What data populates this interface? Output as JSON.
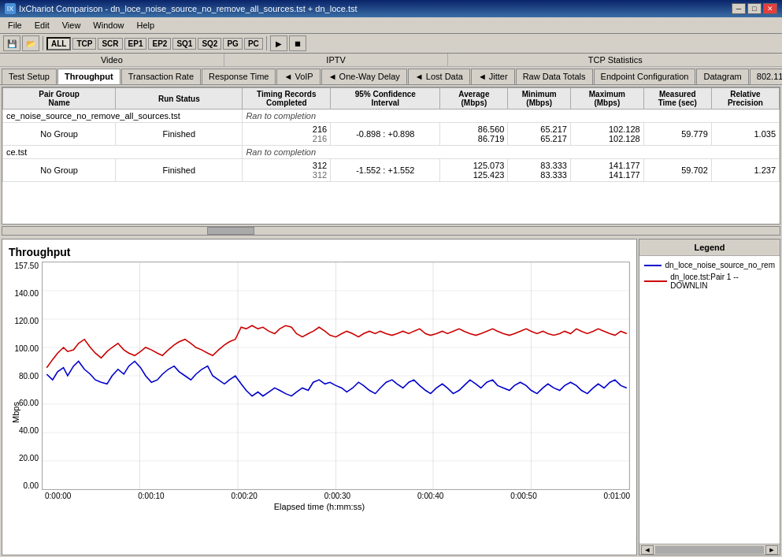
{
  "window": {
    "title": "IxChariot Comparison - dn_loce_noise_source_no_remove_all_sources.tst + dn_loce.tst"
  },
  "titlebar": {
    "minimize": "─",
    "maximize": "□",
    "close": "✕"
  },
  "menu": {
    "items": [
      "File",
      "Edit",
      "View",
      "Window",
      "Help"
    ]
  },
  "toolbar": {
    "tags": [
      "ALL",
      "TCP",
      "SCR",
      "EP1",
      "EP2",
      "SQ1",
      "SQ2",
      "PG",
      "PC"
    ]
  },
  "tabs_top": {
    "video_label": "Video",
    "iptv_label": "IPTV",
    "tcp_label": "TCP Statistics"
  },
  "tabs_main": [
    {
      "label": "Test Setup"
    },
    {
      "label": "Throughput"
    },
    {
      "label": "Transaction Rate"
    },
    {
      "label": "Response Time"
    },
    {
      "label": "◄ VoIP"
    },
    {
      "label": "◄ One-Way Delay"
    },
    {
      "label": "◄ Lost Data"
    },
    {
      "label": "◄ Jitter"
    },
    {
      "label": "Raw Data Totals"
    },
    {
      "label": "Endpoint Configuration"
    },
    {
      "label": "Datagram"
    },
    {
      "label": "802.11"
    }
  ],
  "table": {
    "headers": [
      {
        "label": "Pair Group\nName",
        "width": "80"
      },
      {
        "label": "Run Status",
        "width": "90"
      },
      {
        "label": "Timing Records\nCompleted",
        "width": "70"
      },
      {
        "label": "95% Confidence\nInterval",
        "width": "100"
      },
      {
        "label": "Average\n(Mbps)",
        "width": "60"
      },
      {
        "label": "Minimum\n(Mbps)",
        "width": "60"
      },
      {
        "label": "Maximum\n(Mbps)",
        "width": "70"
      },
      {
        "label": "Measured\nTime (sec)",
        "width": "65"
      },
      {
        "label": "Relative\nPrecision",
        "width": "65"
      }
    ],
    "rows": [
      {
        "type": "file",
        "filename": "ce_noise_source_no_remove_all_sources.tst",
        "completion": "Ran to completion",
        "group": "",
        "status": "",
        "records": "",
        "confidence": "",
        "avg": "",
        "min": "",
        "max": "",
        "time": "",
        "precision": ""
      },
      {
        "type": "data",
        "filename": "",
        "completion": "",
        "group": "No Group",
        "status": "Finished",
        "records": "216",
        "confidence": "-0.898 : +0.898",
        "avg": "86.560\n86.719",
        "min": "65.217\n65.217",
        "max": "102.128\n102.128",
        "time": "59.779",
        "precision": "1.035"
      },
      {
        "type": "file",
        "filename": "ce.tst",
        "completion": "Ran to completion",
        "group": "",
        "status": "",
        "records": "",
        "confidence": "",
        "avg": "",
        "min": "",
        "max": "",
        "time": "",
        "precision": ""
      },
      {
        "type": "data",
        "filename": "",
        "completion": "",
        "group": "No Group",
        "status": "Finished",
        "records": "312",
        "confidence": "-1.552 : +1.552",
        "avg": "125.073\n125.423",
        "min": "83.333\n83.333",
        "max": "141.177\n141.177",
        "time": "59.702",
        "precision": "1.237"
      }
    ]
  },
  "chart": {
    "title": "Throughput",
    "ylabel": "Mbps",
    "xlabel": "Elapsed time (h:mm:ss)",
    "yaxis": [
      "157.50",
      "140.00",
      "120.00",
      "100.00",
      "80.00",
      "60.00",
      "40.00",
      "20.00",
      "0.00"
    ],
    "xaxis": [
      "0:00:00",
      "0:00:10",
      "0:00:20",
      "0:00:30",
      "0:00:40",
      "0:00:50",
      "0:01:00"
    ]
  },
  "legend": {
    "title": "Legend",
    "items": [
      {
        "color": "#0000aa",
        "label": "dn_loce_noise_source_no_rem"
      },
      {
        "color": "#cc0000",
        "label": "dn_loce.tst:Pair 1 -- DOWNLIN"
      }
    ]
  }
}
